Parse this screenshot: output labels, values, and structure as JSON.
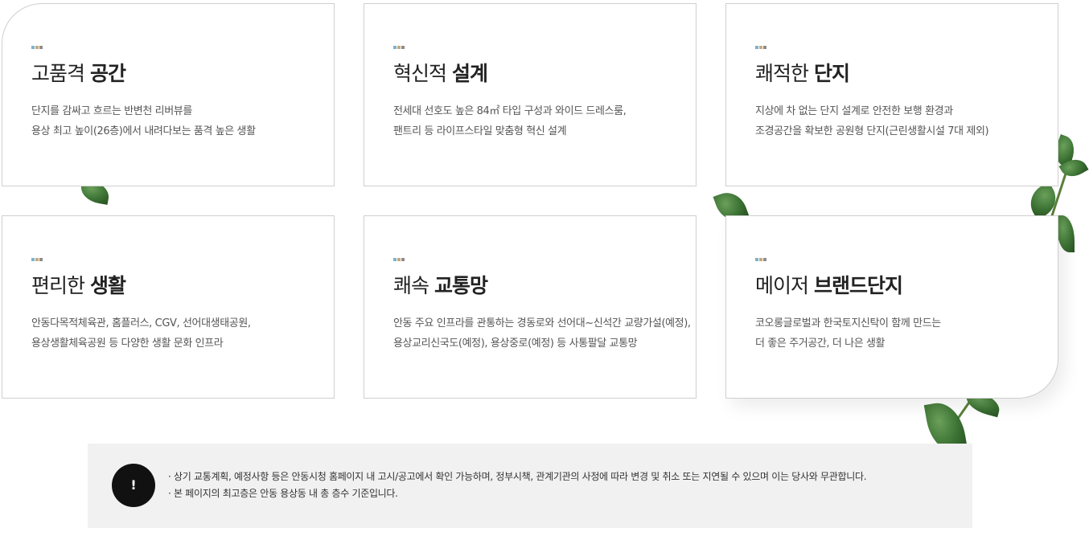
{
  "features": [
    {
      "title_light": "고품격 ",
      "title_bold": "공간",
      "desc_line1": "단지를 감싸고 흐르는 반변천 리버뷰를",
      "desc_line2": "용상 최고 높이(26층)에서 내려다보는 품격 높은 생활"
    },
    {
      "title_light": "혁신적 ",
      "title_bold": "설계",
      "desc_line1": "전세대 선호도 높은 84㎡ 타입 구성과 와이드 드레스룸,",
      "desc_line2": "팬트리 등 라이프스타일 맞춤형 혁신 설계"
    },
    {
      "title_light": "쾌적한 ",
      "title_bold": "단지",
      "desc_line1": "지상에 차 없는 단지 설계로 안전한 보행 환경과",
      "desc_line2": "조경공간을 확보한 공원형 단지(근린생활시설 7대 제외)"
    },
    {
      "title_light": "편리한 ",
      "title_bold": "생활",
      "desc_line1": "안동다목적체육관, 홈플러스, CGV, 선어대생태공원,",
      "desc_line2": "용상생활체육공원 등 다양한 생활 문화 인프라"
    },
    {
      "title_light": "쾌속 ",
      "title_bold": "교통망",
      "desc_line1": "안동 주요 인프라를 관통하는 경동로와 선어대~신석간 교량가설(예정),",
      "desc_line2": "용상교리신국도(예정), 용상중로(예정) 등 사통팔달 교통망"
    },
    {
      "title_light": "메이저 ",
      "title_bold": "브랜드단지",
      "desc_line1": "코오롱글로벌과 한국토지신탁이 함께 만드는",
      "desc_line2": "더 좋은 주거공간, 더 나은 생활"
    }
  ],
  "notice": {
    "icon_label": "!",
    "icon_name": "exclamation-icon",
    "line1": "· 상기 교통계획, 예정사항 등은 안동시청 홈페이지 내 고시/공고에서 확인 가능하며, 정부시책, 관계기관의 사정에 따라 변경 및 취소 또는 지연될 수 있으며 이는 당사와 무관합니다.",
    "line2": "· 본 페이지의 최고층은 안동 용상동 내 총 층수 기준입니다."
  },
  "colors": {
    "dot_blue": "#7fb2c6",
    "dot_tan": "#c8a97a",
    "dot_gray": "#8c8c8c",
    "leaf_green": "#3d7334",
    "notice_bg": "#f1f1f1"
  }
}
